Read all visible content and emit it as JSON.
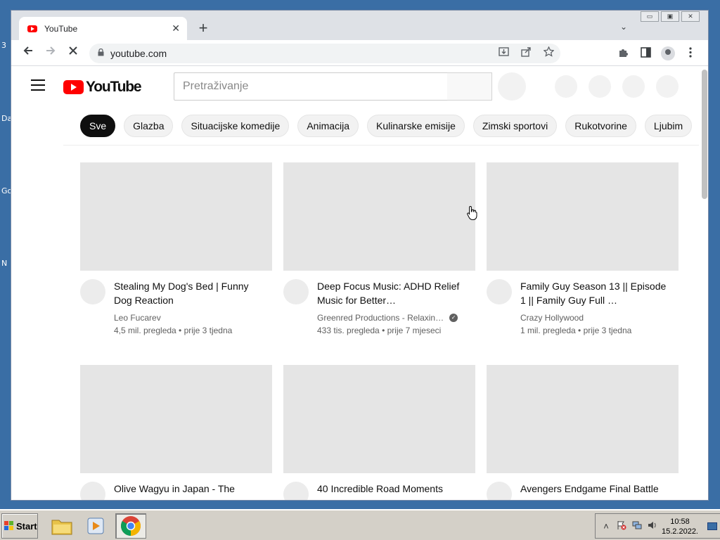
{
  "desktop": {
    "labels": [
      "3",
      "Da",
      "Go",
      "N"
    ]
  },
  "browser": {
    "tab_title": "YouTube",
    "tab_close": "✕",
    "new_tab": "+",
    "tab_search": "⌄",
    "url": "youtube.com",
    "window_buttons": [
      "▭",
      "▣",
      "✕"
    ]
  },
  "youtube": {
    "logo_text": "YouTube",
    "search_placeholder": "Pretraživanje",
    "chips": [
      {
        "label": "Sve",
        "active": true
      },
      {
        "label": "Glazba"
      },
      {
        "label": "Situacijske komedije"
      },
      {
        "label": "Animacija"
      },
      {
        "label": "Kulinarske emisije"
      },
      {
        "label": "Zimski sportovi"
      },
      {
        "label": "Rukotvorine"
      },
      {
        "label": "Ljubim"
      }
    ],
    "videos": [
      {
        "title": "Stealing My Dog's Bed | Funny Dog Reaction",
        "channel": "Leo Fucarev",
        "verified": false,
        "views": "4,5 mil. pregleda",
        "age": "prije 3 tjedna"
      },
      {
        "title": "Deep Focus Music: ADHD Relief Music for Better…",
        "channel": "Greenred Productions - Relaxin…",
        "verified": true,
        "views": "433 tis. pregleda",
        "age": "prije 7 mjeseci"
      },
      {
        "title": "Family Guy Season 13 || Episode 1 || Family Guy Full …",
        "channel": "Crazy Hollywood",
        "verified": false,
        "views": "1 mil. pregleda",
        "age": "prije 3 tjedna"
      },
      {
        "title": "Olive Wagyu in Japan - The",
        "channel": "",
        "verified": false,
        "views": "",
        "age": ""
      },
      {
        "title": "40 Incredible Road Moments",
        "channel": "",
        "verified": false,
        "views": "",
        "age": ""
      },
      {
        "title": "Avengers Endgame Final Battle",
        "channel": "",
        "verified": false,
        "views": "",
        "age": ""
      }
    ]
  },
  "taskbar": {
    "start_label": "Start",
    "time": "10:58",
    "date": "15.2.2022."
  },
  "colors": {
    "youtube_red": "#ff0000",
    "desktop_blue": "#3a6ea5",
    "chip_active_bg": "#0f0f0f"
  }
}
